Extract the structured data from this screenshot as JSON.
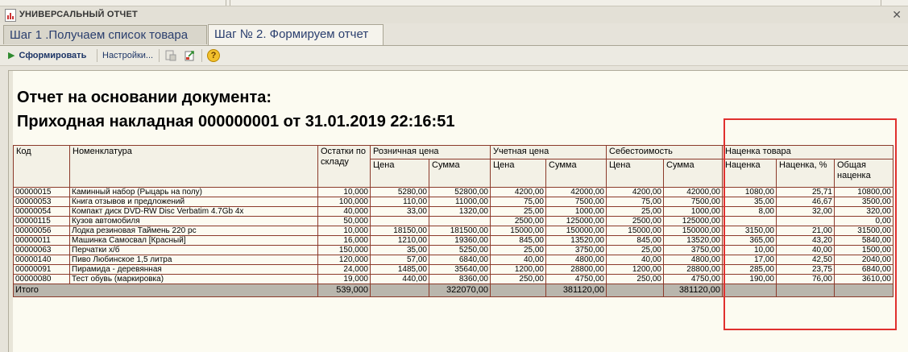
{
  "window": {
    "title": "УНИВЕРСАЛЬНЫЙ ОТЧЕТ",
    "close_glyph": "✕"
  },
  "tabs": [
    {
      "label": "Шаг 1 .Получаем список товара",
      "active": false
    },
    {
      "label": "Шаг № 2. Формируем отчет",
      "active": true
    }
  ],
  "toolbar": {
    "generate_label": "Сформировать",
    "settings_label": "Настройки...",
    "help_glyph": "?"
  },
  "report": {
    "title_line1": "Отчет на основании документа:",
    "title_line2": "Приходная накладная 000000001 от 31.01.2019 22:16:51",
    "headers": {
      "code": "Код",
      "name": "Номенклатура",
      "stock": "Остатки по складу",
      "retail": "Розничная цена",
      "accounting": "Учетная цена",
      "cost": "Себестоимость",
      "markup_group": "Наценка товара",
      "price": "Цена",
      "sum": "Сумма",
      "markup": "Наценка",
      "markup_pct": "Наценка, %",
      "markup_total": "Общая наценка"
    },
    "rows": [
      {
        "code": "00000015",
        "name": "Каминный набор (Рыцарь на полу)",
        "stock": "10,000",
        "retail_price": "5280,00",
        "retail_sum": "52800,00",
        "acc_price": "4200,00",
        "acc_sum": "42000,00",
        "cost_price": "4200,00",
        "cost_sum": "42000,00",
        "markup": "1080,00",
        "markup_pct": "25,71",
        "markup_total": "10800,00"
      },
      {
        "code": "00000053",
        "name": "Книга отзывов и предложений",
        "stock": "100,000",
        "retail_price": "110,00",
        "retail_sum": "11000,00",
        "acc_price": "75,00",
        "acc_sum": "7500,00",
        "cost_price": "75,00",
        "cost_sum": "7500,00",
        "markup": "35,00",
        "markup_pct": "46,67",
        "markup_total": "3500,00"
      },
      {
        "code": "00000054",
        "name": "Компакт диск DVD-RW Disc Verbatim 4.7Gb 4x",
        "stock": "40,000",
        "retail_price": "33,00",
        "retail_sum": "1320,00",
        "acc_price": "25,00",
        "acc_sum": "1000,00",
        "cost_price": "25,00",
        "cost_sum": "1000,00",
        "markup": "8,00",
        "markup_pct": "32,00",
        "markup_total": "320,00"
      },
      {
        "code": "00000115",
        "name": "Кузов автомобиля",
        "stock": "50,000",
        "retail_price": "",
        "retail_sum": "",
        "acc_price": "2500,00",
        "acc_sum": "125000,00",
        "cost_price": "2500,00",
        "cost_sum": "125000,00",
        "markup": "",
        "markup_pct": "",
        "markup_total": "0,00"
      },
      {
        "code": "00000056",
        "name": "Лодка резиновая Таймень 220 рс",
        "stock": "10,000",
        "retail_price": "18150,00",
        "retail_sum": "181500,00",
        "acc_price": "15000,00",
        "acc_sum": "150000,00",
        "cost_price": "15000,00",
        "cost_sum": "150000,00",
        "markup": "3150,00",
        "markup_pct": "21,00",
        "markup_total": "31500,00"
      },
      {
        "code": "00000011",
        "name": "Машинка Самосвал [Красный]",
        "stock": "16,000",
        "retail_price": "1210,00",
        "retail_sum": "19360,00",
        "acc_price": "845,00",
        "acc_sum": "13520,00",
        "cost_price": "845,00",
        "cost_sum": "13520,00",
        "markup": "365,00",
        "markup_pct": "43,20",
        "markup_total": "5840,00"
      },
      {
        "code": "00000063",
        "name": "Перчатки х/б",
        "stock": "150,000",
        "retail_price": "35,00",
        "retail_sum": "5250,00",
        "acc_price": "25,00",
        "acc_sum": "3750,00",
        "cost_price": "25,00",
        "cost_sum": "3750,00",
        "markup": "10,00",
        "markup_pct": "40,00",
        "markup_total": "1500,00"
      },
      {
        "code": "00000140",
        "name": "Пиво Любинское 1,5 литра",
        "stock": "120,000",
        "retail_price": "57,00",
        "retail_sum": "6840,00",
        "acc_price": "40,00",
        "acc_sum": "4800,00",
        "cost_price": "40,00",
        "cost_sum": "4800,00",
        "markup": "17,00",
        "markup_pct": "42,50",
        "markup_total": "2040,00"
      },
      {
        "code": "00000091",
        "name": "Пирамида - деревянная",
        "stock": "24,000",
        "retail_price": "1485,00",
        "retail_sum": "35640,00",
        "acc_price": "1200,00",
        "acc_sum": "28800,00",
        "cost_price": "1200,00",
        "cost_sum": "28800,00",
        "markup": "285,00",
        "markup_pct": "23,75",
        "markup_total": "6840,00"
      },
      {
        "code": "00000080",
        "name": "Тест обувь (маркировка)",
        "stock": "19,000",
        "retail_price": "440,00",
        "retail_sum": "8360,00",
        "acc_price": "250,00",
        "acc_sum": "4750,00",
        "cost_price": "250,00",
        "cost_sum": "4750,00",
        "markup": "190,00",
        "markup_pct": "76,00",
        "markup_total": "3610,00"
      }
    ],
    "total": {
      "label": "Итого",
      "stock": "539,000",
      "retail_sum": "322070,00",
      "acc_sum": "381120,00",
      "cost_sum": "381120,00"
    }
  },
  "colors": {
    "grid_line": "#8b3a2a",
    "annotation": "#e0302e",
    "sheet_bg": "#fcfbf1",
    "total_bg": "#b9b6ad"
  }
}
